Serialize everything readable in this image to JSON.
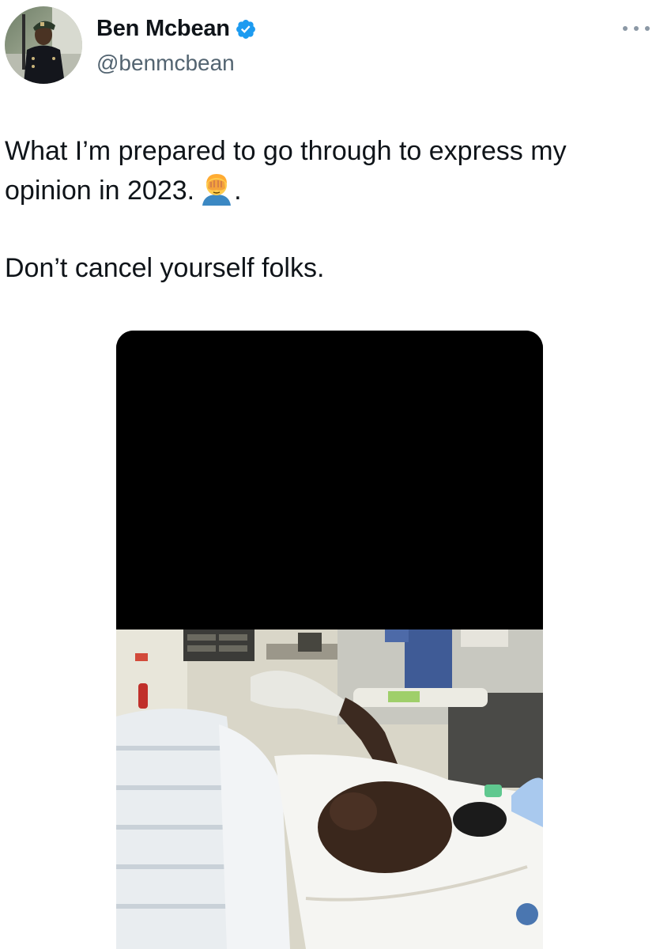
{
  "author": {
    "display_name": "Ben Mcbean",
    "handle": "@benmcbean",
    "verified": true,
    "verified_color": "#1d9bf0"
  },
  "tweet": {
    "line1": "What I’m prepared to go through to express my",
    "line2_text": "opinion in 2023.",
    "line2_emoji": "face-palm-emoji",
    "line2_tail": ".",
    "line3": "Don’t cancel yourself folks."
  },
  "media": {
    "type": "photo",
    "top_portion": "blacked-out"
  },
  "icons": {
    "more": "more-horizontal-icon",
    "verified": "verified-badge-icon"
  }
}
